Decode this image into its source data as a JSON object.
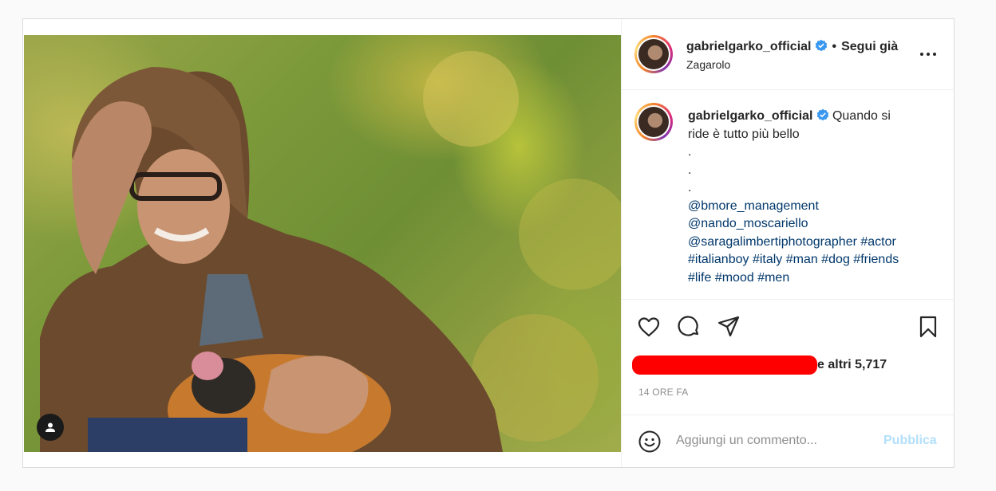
{
  "post": {
    "username": "gabrielgarko_official",
    "follow_separator": "•",
    "follow_label": "Segui già",
    "location": "Zagarolo",
    "caption": {
      "text_line1": "Quando si",
      "text_line2": "ride è tutto più bello",
      "dot1": ".",
      "dot2": ".",
      "dot3": ".",
      "mention1": "@bmore_management",
      "mention2": "@nando_moscariello",
      "mention3": "@saragalimbertiphotographer",
      "tag_actor": "#actor",
      "tag_italianboy": "#italianboy",
      "tag_italy": "#italy",
      "tag_man": "#man",
      "tag_dog": "#dog",
      "tag_friends": "#friends",
      "tag_life": "#life",
      "tag_mood": "#mood",
      "tag_men": "#men"
    },
    "likes_suffix": "e altri 5,717",
    "timestamp": "14 ORE FA",
    "comment_placeholder": "Aggiungi un commento...",
    "publish_label": "Pubblica"
  },
  "icons": {
    "verified": "verified-badge-icon",
    "more": "more-options-icon",
    "like": "heart-icon",
    "comment": "comment-bubble-icon",
    "share": "paper-plane-icon",
    "save": "bookmark-icon",
    "emoji": "emoji-smiley-icon",
    "user_tag": "user-tag-icon"
  },
  "colors": {
    "verified_blue": "#3897f0",
    "link_blue": "#00376b",
    "publish_disabled": "#b2dffc",
    "redaction": "#ff0000"
  }
}
